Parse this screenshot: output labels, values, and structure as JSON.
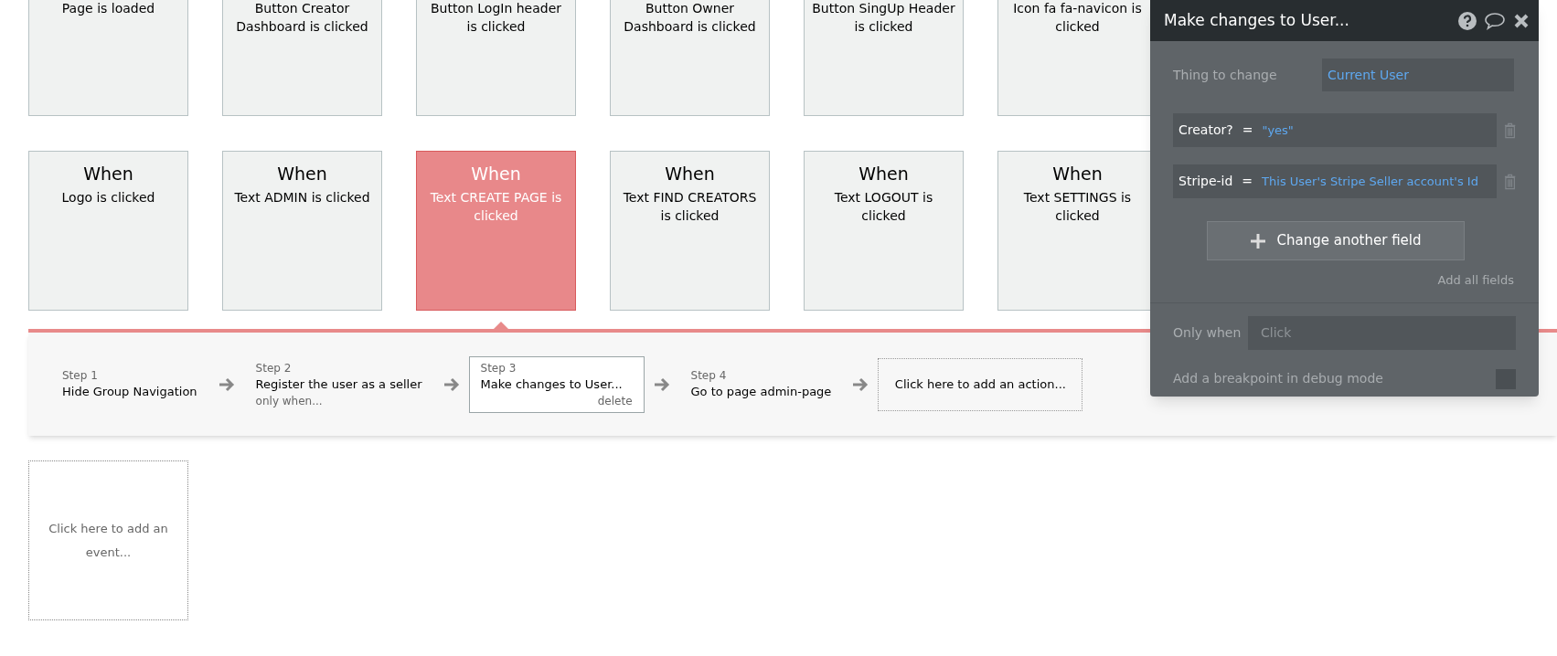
{
  "events_top": [
    {
      "text": "Page is loaded"
    },
    {
      "text": "Button Creator Dashboard is clicked"
    },
    {
      "text": "Button LogIn header is clicked"
    },
    {
      "text": "Button Owner Dashboard is clicked"
    },
    {
      "text": "Button SingUp Header is clicked"
    },
    {
      "text": "Icon fa fa-navicon is clicked"
    }
  ],
  "events": [
    {
      "heading": "When",
      "text": "Logo is clicked",
      "selected": false
    },
    {
      "heading": "When",
      "text": "Text ADMIN is clicked",
      "selected": false
    },
    {
      "heading": "When",
      "text": "Text CREATE PAGE is clicked",
      "selected": true
    },
    {
      "heading": "When",
      "text": "Text FIND CREATORS is clicked",
      "selected": false
    },
    {
      "heading": "When",
      "text": "Text LOGOUT is clicked",
      "selected": false
    },
    {
      "heading": "When",
      "text": "Text SETTINGS is clicked",
      "selected": false
    }
  ],
  "steps": [
    {
      "label": "Step 1",
      "title": "Hide Group Navigation",
      "selected": false
    },
    {
      "label": "Step 2",
      "title": "Register the user as a seller",
      "condition": "only when...",
      "selected": false
    },
    {
      "label": "Step 3",
      "title": "Make changes to User...",
      "action": "delete",
      "selected": true
    },
    {
      "label": "Step 4",
      "title": "Go to page admin-page",
      "selected": false
    }
  ],
  "add_action": "Click here to add an action...",
  "add_event": "Click here to add an event...",
  "popup": {
    "title": "Make changes to User...",
    "thing_label": "Thing to change",
    "thing_value": "Current User",
    "fields": [
      {
        "name": "Creator?",
        "eq": "=",
        "value": "\"yes\""
      },
      {
        "name": "Stripe-id",
        "eq": "=",
        "value": "This User's Stripe Seller account's Id"
      }
    ],
    "change_button": "Change another field",
    "add_all": "Add all fields",
    "only_when_label": "Only when",
    "only_when_placeholder": "Click",
    "breakpoint_label": "Add a breakpoint in debug mode",
    "breakpoint": false
  }
}
